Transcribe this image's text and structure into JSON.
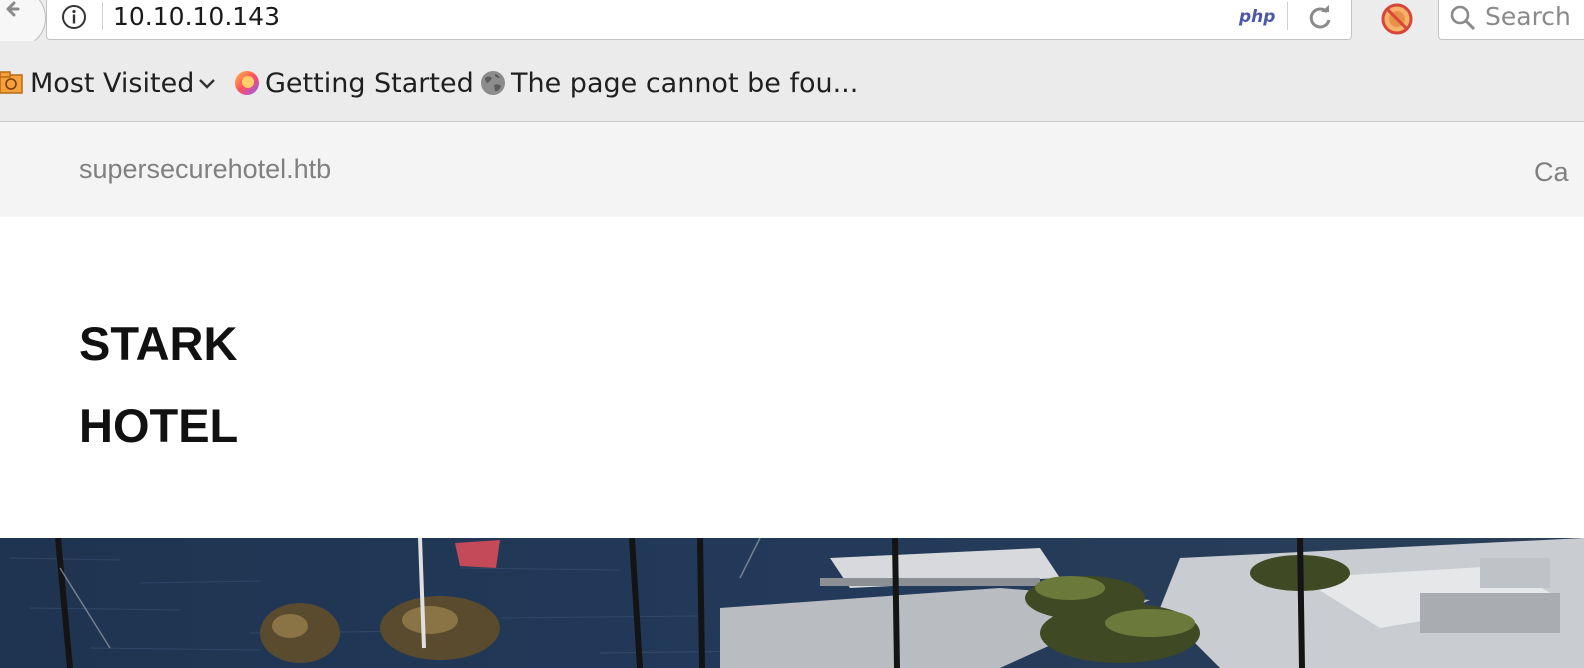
{
  "browser": {
    "url": "10.10.10.143",
    "url_badge": "php",
    "search_placeholder": "Search"
  },
  "bookmarks": {
    "items": [
      {
        "label": "Most Visited",
        "icon": "folder-icon",
        "has_dropdown": true
      },
      {
        "label": "Getting Started",
        "icon": "firefox-icon"
      },
      {
        "label": "The page cannot be fou...",
        "icon": "globe-icon"
      }
    ]
  },
  "site": {
    "domain": "supersecurehotel.htb",
    "nav_partial": "Ca",
    "title_line1": "STARK",
    "title_line2": "HOTEL"
  },
  "colors": {
    "toolbar_bg": "#ececec",
    "site_header_bg": "#f4f4f4",
    "muted_text": "#808080",
    "title_text": "#111111",
    "water": "#20334a"
  }
}
